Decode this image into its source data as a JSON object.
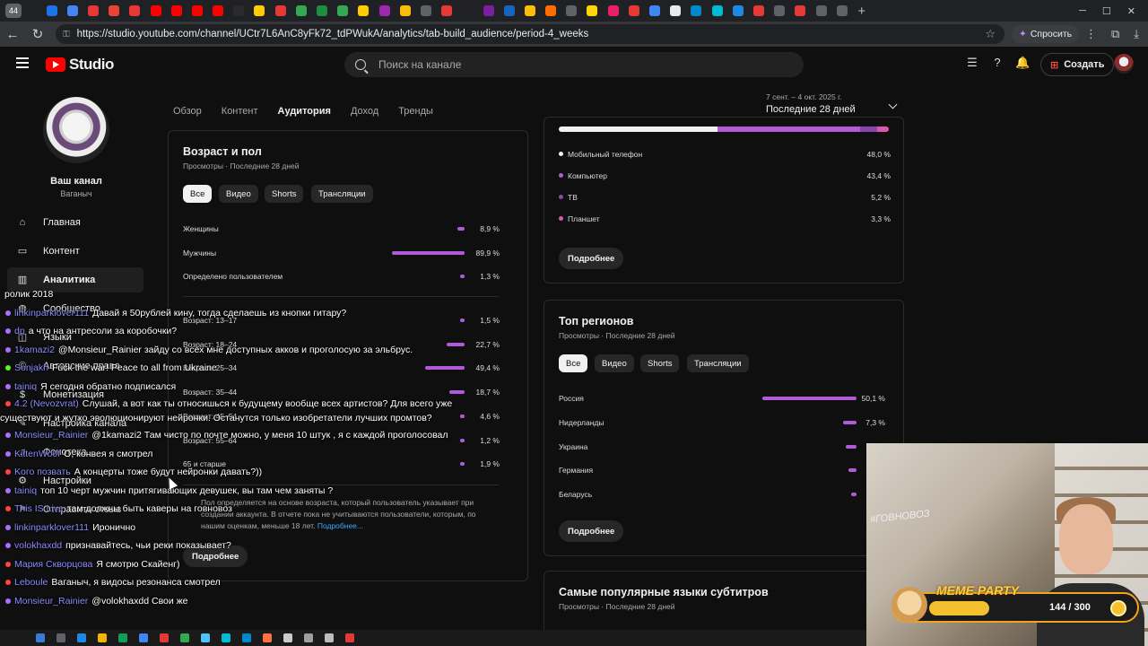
{
  "browser": {
    "tab_count": "44",
    "url": "https://studio.youtube.com/channel/UCtr7L6AnC8yFk72_tdPWukA/analytics/tab-build_audience/period-4_weeks",
    "ask_label": "Спросить",
    "tab_colors": [
      "#1a73e8",
      "#4285f4",
      "#e53935",
      "#ea4335",
      "#e53935",
      "#ff0000",
      "#ff0000",
      "#ff0000",
      "#ff0000",
      "#2b2b2b",
      "#ffcc00",
      "#e53935",
      "#34a853",
      "#1e8e3e",
      "#34a853",
      "#ffcc00",
      "#9c27b0",
      "#fbbc04",
      "#5f6368",
      "#e53935",
      "#222222",
      "#7b1fa2",
      "#1565c0",
      "#fbbc04",
      "#ff6d00",
      "#5f6368",
      "#ffd600",
      "#e91e63",
      "#e53935",
      "#4285f4",
      "#e8eaed",
      "#0088cc",
      "#00bcd4",
      "#1e88e5",
      "#e53935",
      "#5f6368",
      "#e53935",
      "#5f6368",
      "#5f6368"
    ]
  },
  "header": {
    "logo_text": "Studio",
    "search_placeholder": "Поиск на канале",
    "create_label": "Создать"
  },
  "sidebar": {
    "channel_title": "Ваш канал",
    "channel_name": "Ваганыч",
    "items": [
      {
        "label": "Главная",
        "icon": "home-icon"
      },
      {
        "label": "Контент",
        "icon": "content-icon"
      },
      {
        "label": "Аналитика",
        "icon": "analytics-icon"
      },
      {
        "label": "Сообщество",
        "icon": "community-icon"
      },
      {
        "label": "Языки",
        "icon": "subtitles-icon"
      },
      {
        "label": "Авторские права",
        "icon": "copyright-icon"
      },
      {
        "label": "Монетизация",
        "icon": "monetization-icon"
      },
      {
        "label": "Настройка канала",
        "icon": "customization-icon"
      },
      {
        "label": "Фонотека",
        "icon": "audio-library-icon"
      },
      {
        "label": "Настройки",
        "icon": "settings-icon"
      },
      {
        "label": "Отправить отзыв",
        "icon": "feedback-icon"
      }
    ]
  },
  "tabs": [
    "Обзор",
    "Контент",
    "Аудитория",
    "Доход",
    "Тренды"
  ],
  "period": {
    "dates": "7 сент. – 4 окт. 2025 г.",
    "label": "Последние 28 дней"
  },
  "age_gender": {
    "title": "Возраст и пол",
    "subtitle": "Просмотры · Последние 28 дней",
    "chips": [
      "Все",
      "Видео",
      "Shorts",
      "Трансляции"
    ],
    "gender": [
      {
        "label": "Женщины",
        "value": 8.9,
        "text": "8,9 %"
      },
      {
        "label": "Мужчины",
        "value": 89.9,
        "text": "89,9 %"
      },
      {
        "label": "Определено пользователем",
        "value": 1.3,
        "text": "1,3 %"
      }
    ],
    "ages": [
      {
        "label": "Возраст: 13–17",
        "value": 1.5,
        "text": "1,5 %"
      },
      {
        "label": "Возраст: 18–24",
        "value": 22.7,
        "text": "22,7 %"
      },
      {
        "label": "Возраст: 25–34",
        "value": 49.4,
        "text": "49,4 %"
      },
      {
        "label": "Возраст: 35–44",
        "value": 18.7,
        "text": "18,7 %"
      },
      {
        "label": "Возраст: 45–54",
        "value": 4.6,
        "text": "4,6 %"
      },
      {
        "label": "Возраст: 55–64",
        "value": 1.2,
        "text": "1,2 %"
      },
      {
        "label": "65 и старше",
        "value": 1.9,
        "text": "1,9 %"
      }
    ],
    "footnote": "Пол определяется на основе возраста, который пользователь указывает при создании аккаунта. В отчете пока не учитываются пользователи, которым, по нашим оценкам, меньше 18 лет.",
    "footnote_link": "Подробнее...",
    "more_label": "Подробнее"
  },
  "devices": {
    "stack": [
      48.0,
      43.4,
      5.2,
      3.3
    ],
    "items": [
      {
        "label": "Мобильный телефон",
        "text": "48,0 %",
        "color": "#f1f1f1"
      },
      {
        "label": "Компьютер",
        "text": "43,4 %",
        "color": "#b15bd6"
      },
      {
        "label": "ТВ",
        "text": "5,2 %",
        "color": "#8e44ad"
      },
      {
        "label": "Планшет",
        "text": "3,3 %",
        "color": "#e056a8"
      }
    ],
    "more_label": "Подробнее"
  },
  "regions": {
    "title": "Топ регионов",
    "subtitle": "Просмотры · Последние 28 дней",
    "chips": [
      "Все",
      "Видео",
      "Shorts",
      "Трансляции"
    ],
    "items": [
      {
        "label": "Россия",
        "value": 50.1,
        "text": "50,1 %"
      },
      {
        "label": "Нидерланды",
        "value": 7.3,
        "text": "7,3 %"
      },
      {
        "label": "Украина",
        "value": 5.5,
        "text": ""
      },
      {
        "label": "Германия",
        "value": 4.2,
        "text": ""
      },
      {
        "label": "Беларусь",
        "value": 3.0,
        "text": ""
      }
    ],
    "more_label": "Подробнее"
  },
  "subtitles_card": {
    "title": "Самые популярные языки субтитров",
    "subtitle": "Просмотры · Последние 28 дней"
  },
  "chat": [
    {
      "user": "",
      "text": "ролик 2018",
      "ucolor": "#ffffff",
      "badge": ""
    },
    {
      "user": "linkinparklover111",
      "text": "Давай я 50рублей кину, тогда сделаешь из кнопки гитару?",
      "ucolor": "#8c8cff",
      "badge": "#a970ff"
    },
    {
      "user": "dp",
      "text": "а что на антресоли за коробочки?",
      "ucolor": "#8c8cff",
      "badge": "#a970ff"
    },
    {
      "user": "1kamazi2",
      "text": "@Monsieur_Rainier зайду со всех мне доступных акков и проголосую за эльбрус.",
      "ucolor": "#8c8cff",
      "badge": "#a970ff"
    },
    {
      "user": "Sonjakh",
      "text": "Fuck the war! Peace to all from Ukraine",
      "ucolor": "#8c8cff",
      "badge": "#53fc18"
    },
    {
      "user": "tainiq",
      "text": "Я сегодня обратно подписался",
      "ucolor": "#8c8cff",
      "badge": "#a970ff"
    },
    {
      "user": "4.2 (Nevozvrat)",
      "text": "Слушай, а вот как ты относишься к будущему вообще всех артистов? Для всего уже существуют и жутко эволюционируют нейронки. Останутся только изобретатели лучших промтов?",
      "ucolor": "#8c8cff",
      "badge": "#ff4444",
      "wrap": true
    },
    {
      "user": "Monsieur_Rainier",
      "text": "@1kamazi2 Там чисто по почте можно, у меня 10 штук , я с каждой проголосовал",
      "ucolor": "#8c8cff",
      "badge": "#a970ff",
      "wrap": true
    },
    {
      "user": "KittenWo0f",
      "text": "О, конвея я смотрел",
      "ucolor": "#8c8cff",
      "badge": "#a970ff"
    },
    {
      "user": "Kого позвать",
      "text": "А концерты тоже будут нейронки давать?))",
      "ucolor": "#8c8cff",
      "badge": "#ff4444"
    },
    {
      "user": "tainiq",
      "text": "топ 10 черт мужчин притягивающих девушек, вы там чем заняты ?",
      "ucolor": "#8c8cff",
      "badge": "#a970ff"
    },
    {
      "user": "This IS Live",
      "text": "там должны быть каверы на говновоз",
      "ucolor": "#8c8cff",
      "badge": "#ff4444"
    },
    {
      "user": "linkinparklover111",
      "text": "Иронично",
      "ucolor": "#8c8cff",
      "badge": "#a970ff"
    },
    {
      "user": "volokhaxdd",
      "text": "признавайтесь, чьи реки показывает?",
      "ucolor": "#8c8cff",
      "badge": "#a970ff"
    },
    {
      "user": "Мария Скворцова",
      "text": "Я смотрю Скайенг)",
      "ucolor": "#8c8cff",
      "badge": "#ff4444"
    },
    {
      "user": "Leboule",
      "text": "Ваганыч, я видосы резонанса смотрел",
      "ucolor": "#8c8cff",
      "badge": "#ff4444"
    },
    {
      "user": "Monsieur_Rainier",
      "text": "@volokhaxdd Свои же",
      "ucolor": "#8c8cff",
      "badge": "#a970ff"
    }
  ],
  "overlay": {
    "title": "MEME PARTY",
    "score": "144 / 300",
    "progress": 0.48,
    "sign": "#ГОВНОВОЗ"
  }
}
